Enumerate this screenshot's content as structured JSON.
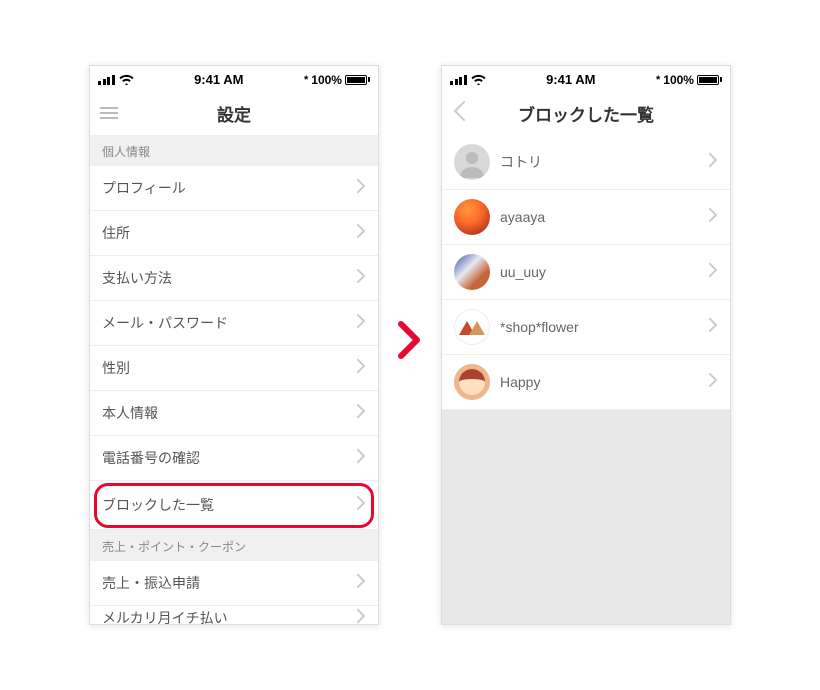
{
  "status": {
    "time": "9:41 AM",
    "battery_text": "100%",
    "bt_symbol": "*"
  },
  "left_screen": {
    "nav_title": "設定",
    "sections": [
      {
        "header": "個人情報",
        "items": [
          "プロフィール",
          "住所",
          "支払い方法",
          "メール・パスワード",
          "性別",
          "本人情報",
          "電話番号の確認",
          "ブロックした一覧"
        ]
      },
      {
        "header": "売上・ポイント・クーポン",
        "items": [
          "売上・振込申請",
          "メルカリ月イチ払い"
        ]
      }
    ]
  },
  "right_screen": {
    "nav_title": "ブロックした一覧",
    "users": [
      "コトリ",
      "ayaaya",
      "uu_uuy",
      "*shop*flower",
      "Happy"
    ]
  }
}
